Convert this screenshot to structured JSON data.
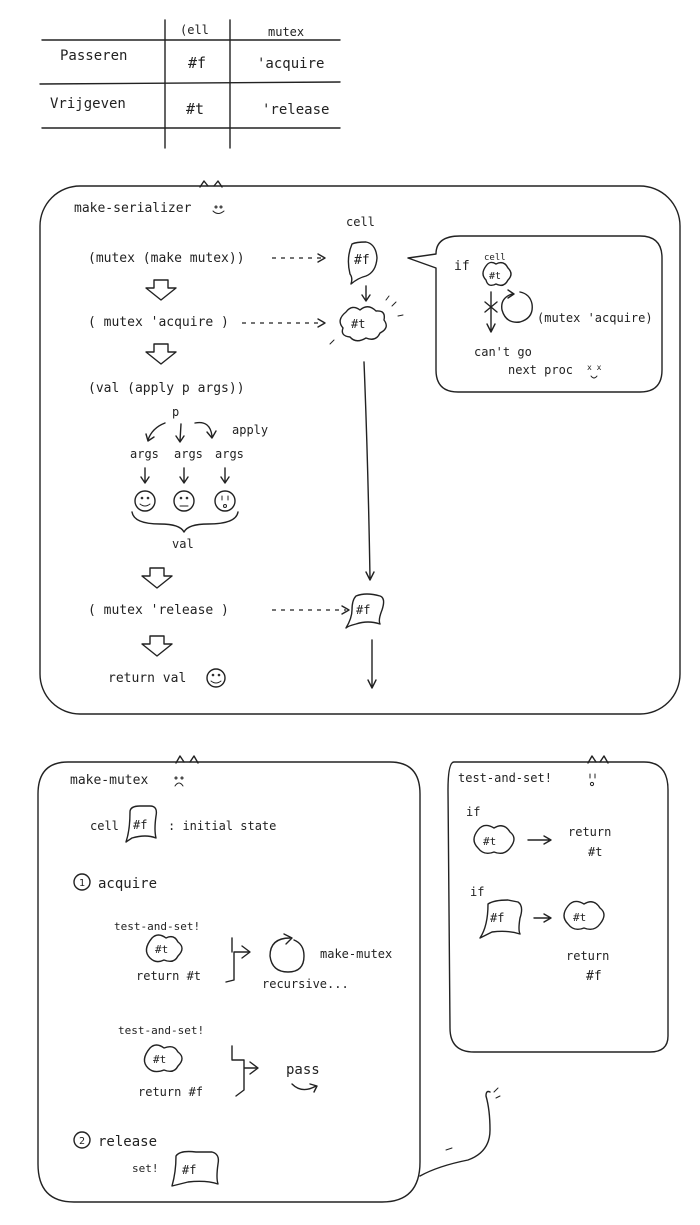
{
  "table": {
    "col_cell": "(ell",
    "col_mutex": "mutex",
    "row1_label": "Passeren",
    "row1_cell": "#f",
    "row1_mutex": "'acquire",
    "row2_label": "Vrijgeven",
    "row2_cell": "#t",
    "row2_mutex": "'release"
  },
  "serializer": {
    "title": "make-serializer",
    "step1": "(mutex (make mutex))",
    "step2": "( mutex  'acquire )",
    "step3": "(val (apply p args))",
    "p_label": "p",
    "apply_label": "apply",
    "args1": "args",
    "args2": "args",
    "args3": "args",
    "val_label": "val",
    "step4": "( mutex   'release )",
    "step5": "return  val",
    "cell_label": "cell",
    "cell_f": "#f",
    "cell_t": "#t",
    "cell_f2": "#f",
    "bubble_if": "if",
    "bubble_cell": "cell",
    "bubble_t": "#t",
    "bubble_acquire": "(mutex 'acquire)",
    "bubble_cant": "can't go",
    "bubble_next": "next proc",
    "bubble_xx": "x x"
  },
  "mutex": {
    "title": "make-mutex",
    "cell_label": "cell",
    "cell_f": "#f",
    "initial_state": ": initial state",
    "acquire_num": "1",
    "acquire_label": "acquire",
    "tas1": "test-and-set!",
    "tas1_t": "#t",
    "tas1_return": "return #t",
    "make_mutex": "make-mutex",
    "recursive": "recursive...",
    "tas2": "test-and-set!",
    "tas2_t": "#t",
    "tas2_return": "return #f",
    "pass": "pass",
    "release_num": "2",
    "release_label": "release",
    "set_label": "set!",
    "set_f": "#f"
  },
  "testandset": {
    "title": "test-and-set!",
    "if1": "if",
    "t1": "#t",
    "return1": "return",
    "return1_val": "#t",
    "if2": "if",
    "f2": "#f",
    "t2": "#t",
    "return2": "return",
    "return2_val": "#f"
  }
}
